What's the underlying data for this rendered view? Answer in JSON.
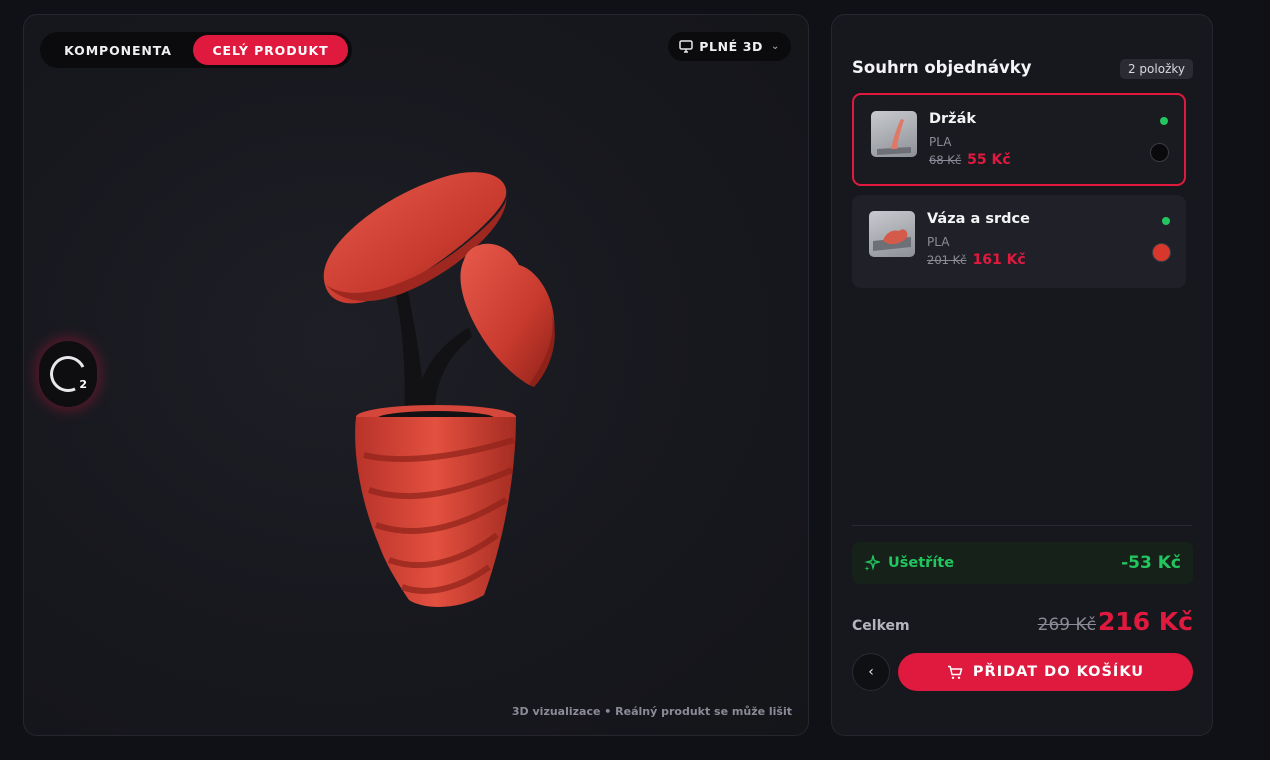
{
  "viewer": {
    "mode_tabs": [
      {
        "label": "KOMPONENTA",
        "active": false
      },
      {
        "label": "CELÝ PRODUKT",
        "active": true
      }
    ],
    "view_select": {
      "label": "PLNÉ 3D",
      "icon": "monitor-icon"
    },
    "component_counter": "2",
    "disclaimer": "3D vizualizace • Reálný produkt se může lišit"
  },
  "summary": {
    "title": "Souhrn objednávky",
    "count_badge": "2 položky",
    "items": [
      {
        "name": "Držák",
        "material": "PLA",
        "old_price": "68 Kč",
        "price": "55 Kč",
        "swatch_color": "#0a0a0c",
        "selected": true
      },
      {
        "name": "Váza a srdce",
        "material": "PLA",
        "old_price": "201 Kč",
        "price": "161 Kč",
        "swatch_color": "#d8382c",
        "selected": false
      }
    ],
    "savings": {
      "label": "Ušetříte",
      "value": "-53 Kč",
      "icon": "sparkle-icon"
    },
    "total": {
      "label": "Celkem",
      "old": "269 Kč",
      "new": "216 Kč"
    },
    "add_to_cart": "PŘIDAT DO KOŠÍKU"
  },
  "colors": {
    "accent": "#e0193f",
    "success": "#22c55e",
    "background": "#101116"
  }
}
